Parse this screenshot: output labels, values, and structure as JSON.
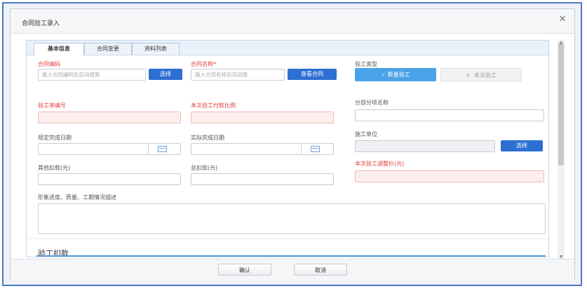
{
  "dialog": {
    "title": "合同验工录入",
    "close_symbol": "✕"
  },
  "tabs": [
    {
      "label": "基本信息",
      "active": true
    },
    {
      "label": "合同变更",
      "active": false
    },
    {
      "label": "资料列表",
      "active": false
    }
  ],
  "form": {
    "contract_code": {
      "label": "合同编码",
      "placeholder": "输入合同编码后自动搜索",
      "button": "选择"
    },
    "contract_name": {
      "label": "合同名称*",
      "placeholder": "输入合同名称后自动搜",
      "button": "查看合同"
    },
    "inspection_type": {
      "label": "验工类型",
      "options": [
        {
          "label": "数量验工",
          "selected": true
        },
        {
          "label": "本次验工",
          "selected": false
        }
      ],
      "checked_mark": "✓",
      "unchecked_mark": "×"
    },
    "inspection_no": {
      "label": "验工单编号"
    },
    "payment_ratio": {
      "label": "本次验工付款比例"
    },
    "sub_project": {
      "label": "分部分项名称"
    },
    "planned_date": {
      "label": "规定完成日期"
    },
    "actual_date": {
      "label": "实际完成日期"
    },
    "construction_unit": {
      "label": "施工单位",
      "button": "选择"
    },
    "other_deduction": {
      "label": "其他扣款(元)"
    },
    "total_deduction": {
      "label": "总扣款(元)"
    },
    "adjust_price": {
      "label": "本次验工调整价(元)"
    },
    "progress_desc": {
      "label": "形象进度、质量、工期情况描述"
    }
  },
  "section": {
    "title": "验工扣款"
  },
  "footer": {
    "confirm": "确认",
    "cancel": "取消"
  },
  "colors": {
    "accent": "#2e6fd3",
    "required": "#e23b3b",
    "error_bg": "#fdeeee",
    "toggle_on": "#4aa3e8",
    "frame": "#4a78c8"
  }
}
